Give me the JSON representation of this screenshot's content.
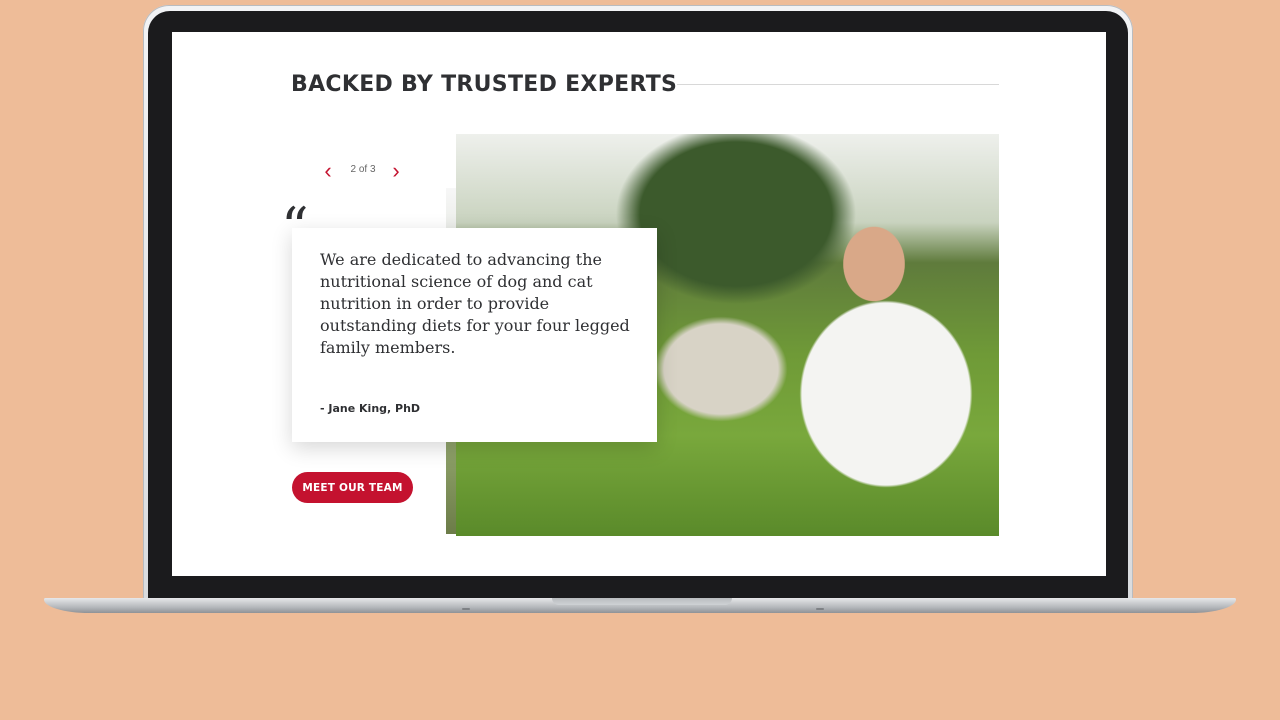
{
  "section": {
    "title": "BACKED BY TRUSTED EXPERTS"
  },
  "pager": {
    "count": "2 of 3",
    "prev_icon": "chevron-left-icon",
    "next_icon": "chevron-right-icon"
  },
  "testimonial": {
    "quote_mark": "“",
    "text": "We are dedicated to advancing the nutritional science of dog and cat nutrition in order to provide outstanding diets for your four legged family members.",
    "author": "- Jane King, PhD"
  },
  "cta": {
    "label": "MEET OUR TEAM"
  },
  "colors": {
    "accent": "#c4122f",
    "background": "#eebc98",
    "text": "#2f3033"
  }
}
